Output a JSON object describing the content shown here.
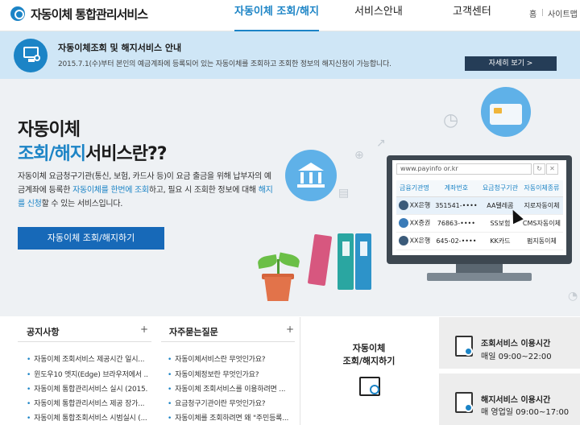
{
  "header": {
    "logo": "자동이체 통합관리서비스",
    "nav": [
      "자동이체 조회/해지",
      "서비스안내",
      "고객센터"
    ],
    "util": [
      "홈",
      "사이트맵"
    ]
  },
  "notice": {
    "title": "자동이체조회 및 해지서비스 안내",
    "desc": "2015.7.1(수)부터 본인의 예금계좌에 등록되어 있는 자동이체를 조회하고 조회한 정보의 해지신청이 가능합니다.",
    "button": "자세히 보기  >"
  },
  "hero": {
    "title1": "자동이체",
    "title2_hl": "조회/해지",
    "title2_rest": "서비스란??",
    "desc_a": "자동이체 요금청구기관(통신, 보험, 카드사 등)이 요금 출금을 위해 납부자의 예금계좌에 등록한 ",
    "desc_hl1": "자동이체를 한번에 조회",
    "desc_b": "하고, 필요 시 조회한 정보에 대해 ",
    "desc_hl2": "해지를 신청",
    "desc_c": "할 수 있는 서비스입니다.",
    "button": "자동이체 조회/해지하기"
  },
  "screen": {
    "url": "www.payinfo or.kr",
    "headers": [
      "금융기관명",
      "계좌번호",
      "요금청구기관",
      "자동이체종류"
    ],
    "rows": [
      [
        "XX은행",
        "351541-••••",
        "AA텔레콤",
        "지로자동이체"
      ],
      [
        "XX증권",
        "76863-••••",
        "SS보험",
        "CMS자동이체"
      ],
      [
        "XX은행",
        "645-02-••••",
        "KK카드",
        "펌지동이체"
      ]
    ]
  },
  "notices": {
    "title": "공지사항",
    "items": [
      "자동이체 조회서비스 제공시간 일시...",
      "윈도우10 엣지(Edge) 브라우저에서 ...",
      "자동이체 통합관리서비스 실시 (2015...",
      "자동이체 통합관리서비스 제공 장가...",
      "자동이체 통합조회서비스 시범실시 (..."
    ]
  },
  "faq": {
    "title": "자주묻는질문",
    "items": [
      "자동이체서비스란 무엇인가요?",
      "자동이체정보란 무엇인가요?",
      "자동이체 조회서비스를 이용하려면 ...",
      "요금청구기관이란 무엇인가요?",
      "자동이체를 조회하려면 왜 \"주민등록..."
    ]
  },
  "quick": {
    "line1": "자동이체",
    "line2": "조회/해지하기"
  },
  "hours": [
    {
      "title": "조회서비스 이용시간",
      "time": "매일 09:00~22:00"
    },
    {
      "title": "해지서비스 이용시간",
      "time": "매 영업일 09:00~17:00"
    }
  ],
  "colors": {
    "accent": "#1c84c6",
    "dark_button": "#253d57",
    "notice_bg": "#cfe6f6",
    "hero_bg": "#eef1f4"
  }
}
